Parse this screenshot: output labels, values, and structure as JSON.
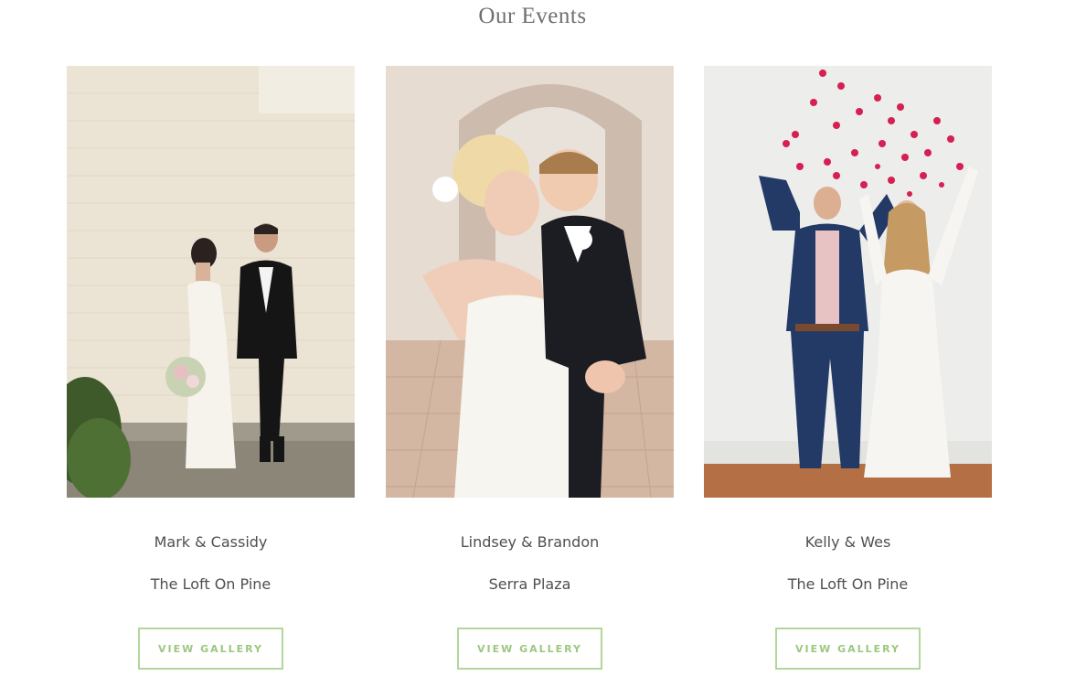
{
  "section": {
    "title": "Our Events"
  },
  "events": [
    {
      "couple": "Mark & Cassidy",
      "venue": "The Loft On Pine",
      "button_label": "VIEW GALLERY"
    },
    {
      "couple": "Lindsey & Brandon",
      "venue": "Serra Plaza",
      "button_label": "VIEW GALLERY"
    },
    {
      "couple": "Kelly & Wes",
      "venue": "The Loft On Pine",
      "button_label": "VIEW GALLERY"
    }
  ],
  "colors": {
    "accent": "#9cc77e",
    "button_border": "#b3d69a",
    "text": "#4f4f4f",
    "title": "#6f6f6f"
  }
}
